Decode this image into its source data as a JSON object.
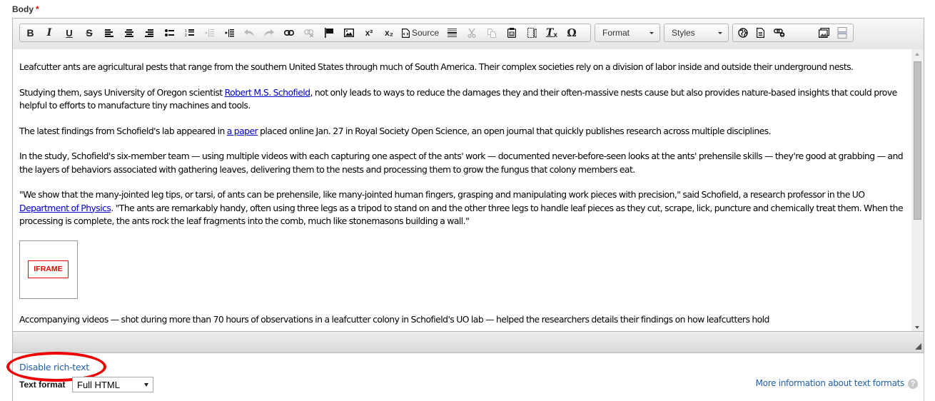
{
  "field": {
    "label": "Body",
    "required_marker": "*"
  },
  "toolbar": {
    "buttons": [
      {
        "name": "bold",
        "glyph": "B",
        "enabled": true
      },
      {
        "name": "italic",
        "glyph": "I",
        "enabled": true
      },
      {
        "name": "underline",
        "glyph": "U",
        "enabled": true
      },
      {
        "name": "strikethrough",
        "glyph": "S",
        "enabled": true
      },
      {
        "name": "align-left",
        "enabled": true
      },
      {
        "name": "align-center",
        "enabled": true
      },
      {
        "name": "align-right",
        "enabled": true
      },
      {
        "name": "bulleted-list",
        "enabled": true
      },
      {
        "name": "numbered-list",
        "enabled": true
      },
      {
        "name": "outdent",
        "enabled": false
      },
      {
        "name": "indent",
        "enabled": true
      },
      {
        "name": "undo",
        "enabled": false
      },
      {
        "name": "redo",
        "enabled": false
      },
      {
        "name": "link",
        "enabled": true
      },
      {
        "name": "unlink",
        "enabled": false
      },
      {
        "name": "anchor",
        "enabled": true
      },
      {
        "name": "image",
        "enabled": true
      },
      {
        "name": "superscript",
        "glyph": "x²",
        "enabled": true
      },
      {
        "name": "subscript",
        "glyph": "x₂",
        "enabled": true
      },
      {
        "name": "source",
        "label": "Source",
        "enabled": true
      },
      {
        "name": "horizontal-rule",
        "enabled": true
      },
      {
        "name": "cut",
        "enabled": false
      },
      {
        "name": "copy",
        "enabled": false
      },
      {
        "name": "paste-from-word",
        "enabled": true
      },
      {
        "name": "show-blocks",
        "enabled": true
      },
      {
        "name": "remove-format",
        "glyph": "Tx",
        "enabled": true
      },
      {
        "name": "special-character",
        "glyph": "Ω",
        "enabled": true
      }
    ],
    "format_combo": "Format",
    "styles_combo": "Styles",
    "extra_buttons": [
      "globe",
      "document",
      "link-add",
      "image-gallery",
      "page-break"
    ]
  },
  "content": {
    "paragraphs": [
      {
        "text": "Leafcutter ants are agricultural pests that range from the southern United States through much of South America. Their complex societies rely on a division of labor inside and outside their underground nests."
      },
      {
        "before": "Studying them, says University of Oregon scientist ",
        "link": "Robert M.S. Schofield",
        "after": ", not only leads to ways to reduce the damages they and their often-massive nests cause but also provides nature-based insights that could prove helpful to efforts to manufacture tiny machines and tools."
      },
      {
        "before": "The latest findings from Schofield's lab appeared in ",
        "link": "a paper",
        "after": " placed online Jan. 27 in Royal Society Open Science, an open journal that quickly publishes research across multiple disciplines."
      },
      {
        "text": "In the study, Schofield's six-member team — using multiple videos with each capturing one aspect of the ants' work — documented never-before-seen looks at the ants' prehensile skills — they're good at grabbing — and the layers of behaviors associated with gathering leaves, delivering them to the nests and processing them to grow the fungus that colony members eat."
      },
      {
        "before": "\"We show that the many-jointed leg tips, or tarsi, of ants can be prehensile, like many-jointed human fingers, grasping and manipulating work pieces with precision,\" said Schofield, a research professor in the UO ",
        "link": "Department of Physics",
        "after": ". \"The ants are remarkably handy, often using three legs as a tripod to stand on and the other three legs to handle leaf pieces as they cut, scrape, lick, puncture and chemically treat them. When the processing is complete, the ants rock the leaf fragments into the comb, much like stonemasons building a wall.\""
      }
    ],
    "iframe_placeholder": "IFRAME",
    "partial_paragraph": "Accompanying videos — shot during more than 70 hours of observations in a leafcutter colony in Schofield's UO lab — helped the researchers details their findings on how leafcutters hold"
  },
  "footer": {
    "disable_rich_text": "Disable rich-text",
    "text_format_label": "Text format",
    "text_format_value": "Full HTML",
    "more_info_link": "More information about text formats",
    "help_glyph": "?"
  },
  "annotation": {
    "color": "#ee0000",
    "target": "Disable rich-text"
  }
}
